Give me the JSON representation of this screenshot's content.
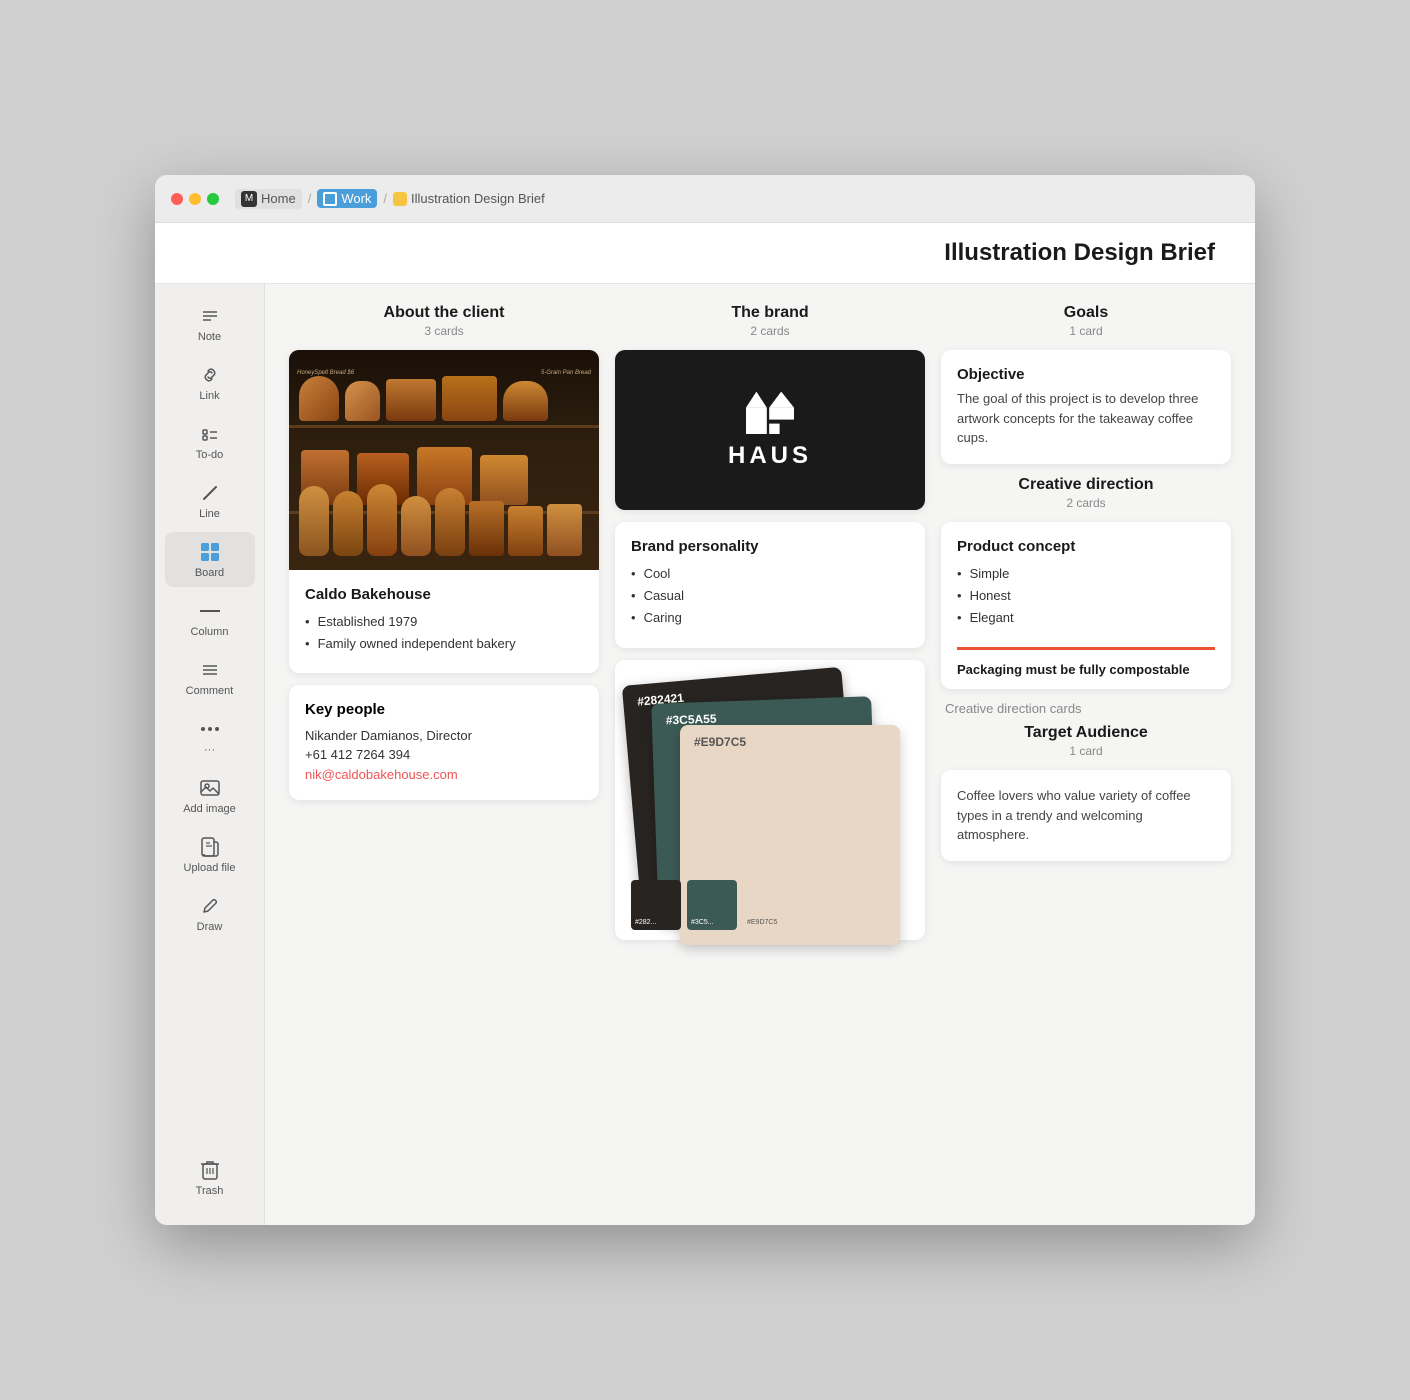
{
  "window": {
    "title": "Illustration Design Brief"
  },
  "titlebar": {
    "home_label": "Home",
    "work_label": "Work",
    "brief_label": "Illustration Design Brief"
  },
  "page": {
    "title": "Illustration Design Brief"
  },
  "sidebar": {
    "items": [
      {
        "id": "note",
        "label": "Note",
        "icon": "≡"
      },
      {
        "id": "link",
        "label": "Link",
        "icon": "🔗"
      },
      {
        "id": "todo",
        "label": "To-do",
        "icon": "⊟"
      },
      {
        "id": "line",
        "label": "Line",
        "icon": "/"
      },
      {
        "id": "board",
        "label": "Board",
        "icon": "⊞"
      },
      {
        "id": "column",
        "label": "Column",
        "icon": "—"
      },
      {
        "id": "comment",
        "label": "Comment",
        "icon": "≡"
      },
      {
        "id": "more",
        "label": "···",
        "icon": "···"
      },
      {
        "id": "add-image",
        "label": "Add image",
        "icon": "🖼"
      },
      {
        "id": "upload",
        "label": "Upload file",
        "icon": "📄"
      },
      {
        "id": "draw",
        "label": "Draw",
        "icon": "✏"
      }
    ],
    "trash_label": "Trash"
  },
  "columns": [
    {
      "id": "about-client",
      "title": "About the client",
      "card_count": "3 cards"
    },
    {
      "id": "the-brand",
      "title": "The brand",
      "card_count": "2 cards"
    },
    {
      "id": "goals",
      "title": "Goals",
      "card_count": "1 card"
    }
  ],
  "about_client_card": {
    "name": "Caldo Bakehouse",
    "details": [
      "Established 1979",
      "Family owned independent bakery"
    ],
    "key_people_label": "Key people",
    "contact_name": "Nikander Damianos, Director",
    "contact_phone": "+61 412 7264 394",
    "contact_email": "nik@caldobakehouse.com"
  },
  "brand_personality_card": {
    "title": "Brand personality",
    "traits": [
      "Cool",
      "Casual",
      "Caring"
    ]
  },
  "brand_logo": {
    "name": "HAUS"
  },
  "color_swatches": [
    {
      "hex": "#282421",
      "label": "#282421"
    },
    {
      "hex": "#3C5A55",
      "label": "#3C5A55"
    },
    {
      "hex": "#E9D7C5",
      "label": "#E9D7C5"
    }
  ],
  "goals_section": {
    "objective_label": "Objective",
    "objective_text": "The goal of this project is to develop three artwork concepts for the takeaway coffee cups."
  },
  "creative_direction": {
    "title": "Creative direction",
    "card_count": "2 cards",
    "product_concept_label": "Product concept",
    "items": [
      "Simple",
      "Honest",
      "Elegant"
    ],
    "packaging_note": "Packaging must be fully compostable",
    "creative_direction_cards_label": "Creative direction cards"
  },
  "target_audience": {
    "title": "Target Audience",
    "card_count": "1 card",
    "text": "Coffee lovers who value variety of coffee types in a trendy and welcoming atmosphere."
  }
}
